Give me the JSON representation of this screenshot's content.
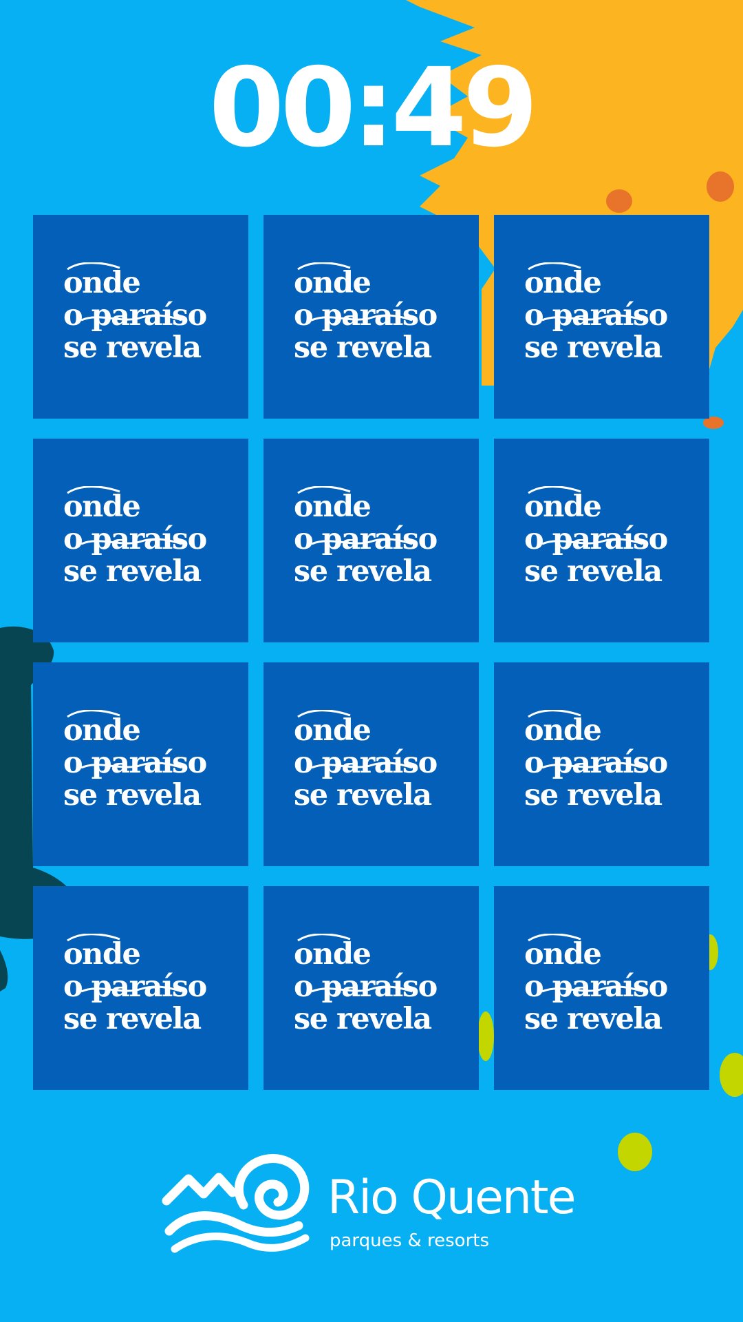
{
  "timer": {
    "value": "00:49"
  },
  "card_text": {
    "line1": "onde",
    "line2": "o paraíso",
    "line3": "se revela"
  },
  "grid": {
    "rows": 4,
    "columns": 3,
    "face_down_cards": 12
  },
  "brand": {
    "name": "Rio Quente",
    "tagline": "parques & resorts"
  },
  "colors": {
    "background": "#06b0f3",
    "card": "#045fb8",
    "sun": "#fcb521",
    "sun_spots": "#e8732a",
    "leaf": "#064551",
    "lime": "#c4d600",
    "text": "#ffffff"
  },
  "icons": [
    "sun-decoration",
    "leaf-decoration",
    "lime-dot-decoration",
    "rio-quente-logo-icon"
  ]
}
